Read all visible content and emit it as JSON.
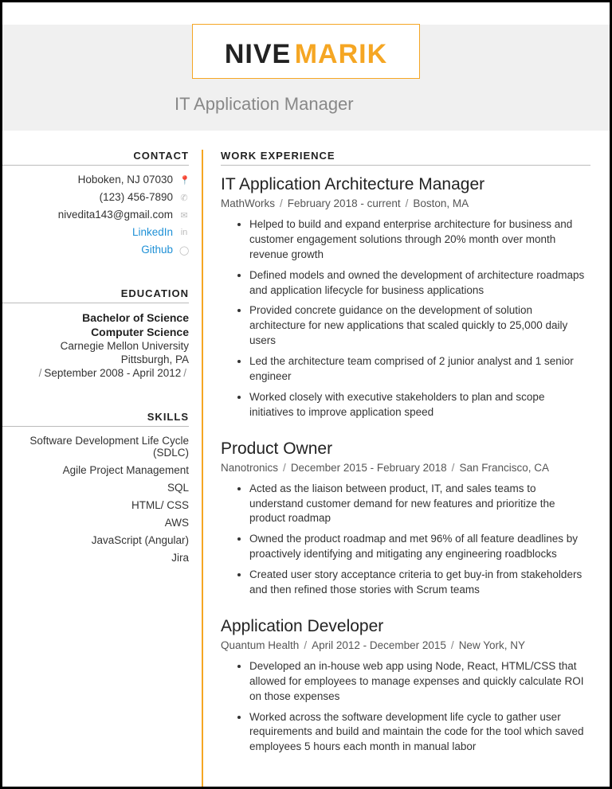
{
  "name": {
    "first": "NIVE",
    "last": "MARIK"
  },
  "title": "IT Application Manager",
  "sidebar": {
    "contact": {
      "heading": "CONTACT",
      "city": "Hoboken, NJ 07030",
      "phone": "(123) 456-7890",
      "email": "nivedita143@gmail.com",
      "linkedin": "LinkedIn",
      "github": "Github"
    },
    "education": {
      "heading": "EDUCATION",
      "degree": "Bachelor of Science",
      "field": "Computer Science",
      "school": "Carnegie Mellon University",
      "location": "Pittsburgh, PA",
      "dates": "September 2008 - April 2012"
    },
    "skills": {
      "heading": "SKILLS",
      "items": [
        "Software Development Life Cycle (SDLC)",
        "Agile Project Management",
        "SQL",
        "HTML/ CSS",
        "AWS",
        "JavaScript (Angular)",
        "Jira"
      ]
    }
  },
  "main": {
    "heading": "WORK EXPERIENCE",
    "jobs": [
      {
        "title": "IT Application Architecture Manager",
        "company": "MathWorks",
        "dates": "February 2018 - current",
        "location": "Boston, MA",
        "bullets": [
          "Helped to build and expand enterprise architecture for business and customer engagement solutions through 20% month over month revenue growth",
          "Defined models and owned the development of architecture roadmaps and application lifecycle for business applications",
          "Provided concrete guidance on the development of solution architecture for new applications that scaled quickly to 25,000 daily users",
          "Led the architecture team comprised of 2 junior analyst and 1 senior engineer",
          "Worked closely with executive stakeholders to plan and scope initiatives to improve application speed"
        ]
      },
      {
        "title": "Product Owner",
        "company": "Nanotronics",
        "dates": "December 2015 - February 2018",
        "location": "San Francisco, CA",
        "bullets": [
          "Acted as the liaison between product, IT, and sales teams to understand customer demand for new features and prioritize the product roadmap",
          "Owned the product roadmap and met 96% of all feature deadlines by proactively identifying and mitigating any engineering roadblocks",
          "Created user story acceptance criteria to get buy-in from stakeholders and then refined those stories with Scrum teams"
        ]
      },
      {
        "title": "Application Developer",
        "company": "Quantum Health",
        "dates": "April 2012 - December 2015",
        "location": "New York, NY",
        "bullets": [
          "Developed an in-house web app using Node, React, HTML/CSS that allowed for employees to manage expenses and quickly calculate ROI on those expenses",
          "Worked across the software development life cycle to gather user requirements and build and maintain the code for the tool which saved employees 5 hours each month in manual labor"
        ]
      }
    ]
  }
}
